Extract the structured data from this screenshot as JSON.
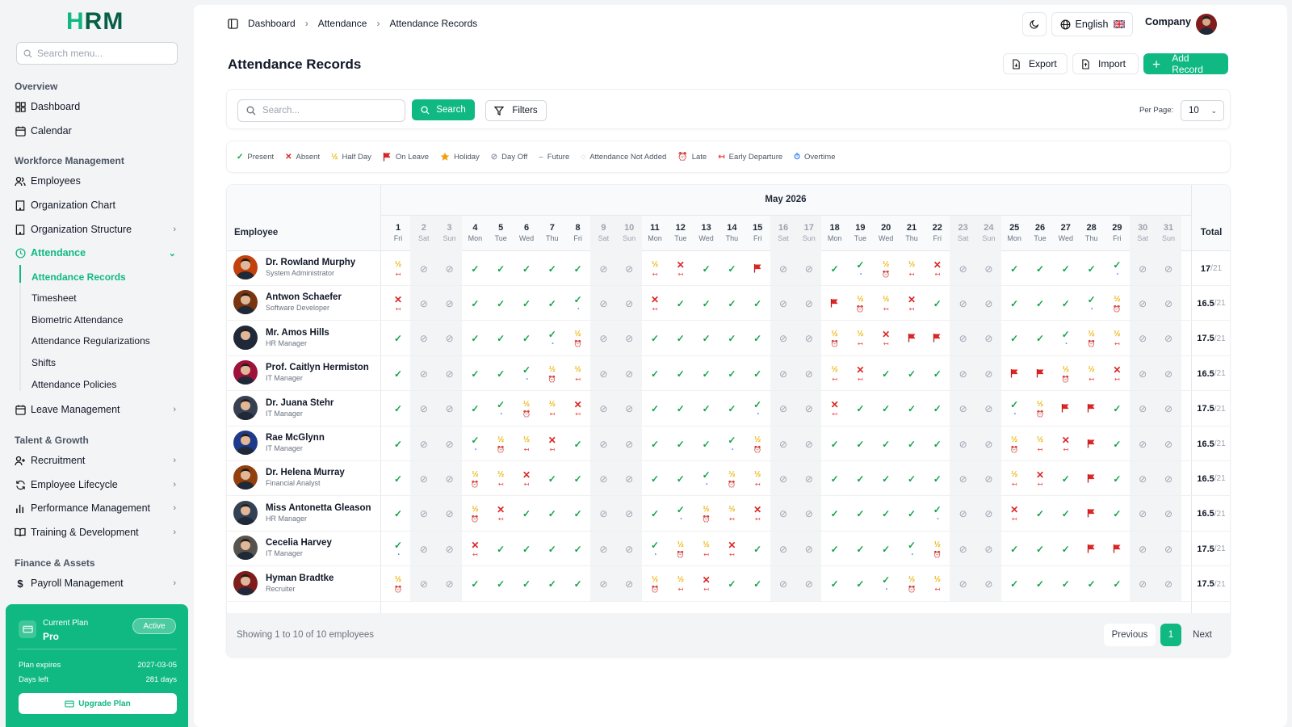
{
  "brand": {
    "logo": "HRM",
    "accent": "#10b981"
  },
  "sidebar": {
    "search_placeholder": "Search menu...",
    "sections": {
      "overview": "Overview",
      "workforce": "Workforce Management",
      "talent": "Talent & Growth",
      "finance": "Finance & Assets"
    },
    "items": {
      "dashboard": "Dashboard",
      "calendar": "Calendar",
      "employees": "Employees",
      "org_chart": "Organization Chart",
      "org_structure": "Organization Structure",
      "attendance": "Attendance",
      "leave": "Leave Management",
      "recruitment": "Recruitment",
      "lifecycle": "Employee Lifecycle",
      "performance": "Performance Management",
      "training": "Training & Development",
      "payroll": "Payroll Management"
    },
    "attendance_sub": [
      "Attendance Records",
      "Timesheet",
      "Biometric Attendance",
      "Attendance Regularizations",
      "Shifts",
      "Attendance Policies"
    ],
    "plan": {
      "label": "Current Plan",
      "name": "Pro",
      "status": "Active",
      "expires_label": "Plan expires",
      "expires_value": "2027-03-05",
      "days_label": "Days left",
      "days_value": "281 days",
      "upgrade": "Upgrade Plan"
    }
  },
  "topbar": {
    "breadcrumb": [
      "Dashboard",
      "Attendance",
      "Attendance Records"
    ],
    "language": "English",
    "company": "Company"
  },
  "page": {
    "title": "Attendance Records",
    "export": "Export",
    "import": "Import",
    "add": "Add Record",
    "search_placeholder": "Search...",
    "search_btn": "Search",
    "filters_btn": "Filters",
    "per_page_label": "Per Page:",
    "per_page_value": "10"
  },
  "legend": [
    {
      "sym": "✓",
      "cls": "p",
      "label": "Present"
    },
    {
      "sym": "✕",
      "cls": "a",
      "label": "Absent"
    },
    {
      "sym": "½",
      "cls": "h",
      "label": "Half Day"
    },
    {
      "sym": "flag",
      "cls": "lv",
      "label": "On Leave"
    },
    {
      "sym": "star",
      "cls": "hol",
      "label": "Holiday"
    },
    {
      "sym": "⊘",
      "cls": "o",
      "label": "Day Off"
    },
    {
      "sym": "–",
      "cls": "o",
      "label": "Future"
    },
    {
      "sym": "◌",
      "cls": "o",
      "label": "Attendance Not Added"
    },
    {
      "sym": "⏰",
      "cls": "l",
      "label": "Late"
    },
    {
      "sym": "↤",
      "cls": "e",
      "label": "Early Departure"
    },
    {
      "sym": "⏱",
      "cls": "v",
      "label": "Overtime"
    }
  ],
  "table": {
    "month": "May 2026",
    "employee_header": "Employee",
    "total_header": "Total",
    "days": [
      {
        "n": "1",
        "w": "Fri"
      },
      {
        "n": "2",
        "w": "Sat"
      },
      {
        "n": "3",
        "w": "Sun"
      },
      {
        "n": "4",
        "w": "Mon"
      },
      {
        "n": "5",
        "w": "Tue"
      },
      {
        "n": "6",
        "w": "Wed"
      },
      {
        "n": "7",
        "w": "Thu"
      },
      {
        "n": "8",
        "w": "Fri"
      },
      {
        "n": "9",
        "w": "Sat"
      },
      {
        "n": "10",
        "w": "Sun"
      },
      {
        "n": "11",
        "w": "Mon"
      },
      {
        "n": "12",
        "w": "Tue"
      },
      {
        "n": "13",
        "w": "Wed"
      },
      {
        "n": "14",
        "w": "Thu"
      },
      {
        "n": "15",
        "w": "Fri"
      },
      {
        "n": "16",
        "w": "Sat"
      },
      {
        "n": "17",
        "w": "Sun"
      },
      {
        "n": "18",
        "w": "Mon"
      },
      {
        "n": "19",
        "w": "Tue"
      },
      {
        "n": "20",
        "w": "Wed"
      },
      {
        "n": "21",
        "w": "Thu"
      },
      {
        "n": "22",
        "w": "Fri"
      },
      {
        "n": "23",
        "w": "Sat"
      },
      {
        "n": "24",
        "w": "Sun"
      },
      {
        "n": "25",
        "w": "Mon"
      },
      {
        "n": "26",
        "w": "Tue"
      },
      {
        "n": "27",
        "w": "Wed"
      },
      {
        "n": "28",
        "w": "Thu"
      },
      {
        "n": "29",
        "w": "Fri"
      },
      {
        "n": "30",
        "w": "Sat"
      },
      {
        "n": "31",
        "w": "Sun"
      }
    ],
    "rows": [
      {
        "name": "Dr. Rowland Murphy",
        "role": "System Administrator",
        "total": "17",
        "of": "/21",
        "cells": [
          "H:e",
          "O",
          "O",
          "P",
          "P",
          "P",
          "P",
          "P",
          "O",
          "O",
          "H:e",
          "A:e",
          "P",
          "P",
          "L",
          "O",
          "O",
          "P",
          "P:v",
          "H:l",
          "H:e",
          "A:e",
          "O",
          "O",
          "P",
          "P",
          "P",
          "P",
          "P:v",
          "O",
          "O"
        ]
      },
      {
        "name": "Antwon Schaefer",
        "role": "Software Developer",
        "total": "16.5",
        "of": "/21",
        "cells": [
          "A:e",
          "O",
          "O",
          "P",
          "P",
          "P",
          "P",
          "P:v",
          "O",
          "O",
          "A:e",
          "P",
          "P",
          "P",
          "P",
          "O",
          "O",
          "L",
          "H:l",
          "H:e",
          "A:e",
          "P",
          "O",
          "O",
          "P",
          "P",
          "P",
          "P:v",
          "H:l",
          "O",
          "O"
        ]
      },
      {
        "name": "Mr. Amos Hills",
        "role": "HR Manager",
        "total": "17.5",
        "of": "/21",
        "cells": [
          "P",
          "O",
          "O",
          "P",
          "P",
          "P",
          "P:v",
          "H:l",
          "O",
          "O",
          "P",
          "P",
          "P",
          "P",
          "P",
          "O",
          "O",
          "H:l",
          "H:e",
          "A:e",
          "L",
          "L",
          "O",
          "O",
          "P",
          "P",
          "P:v",
          "H:l",
          "H:e",
          "O",
          "O"
        ]
      },
      {
        "name": "Prof. Caitlyn Hermiston",
        "role": "IT Manager",
        "total": "16.5",
        "of": "/21",
        "cells": [
          "P",
          "O",
          "O",
          "P",
          "P",
          "P:v",
          "H:l",
          "H:e",
          "O",
          "O",
          "P",
          "P",
          "P",
          "P",
          "P",
          "O",
          "O",
          "H:e",
          "A:e",
          "P",
          "P",
          "P",
          "O",
          "O",
          "L",
          "L",
          "H:l",
          "H:e",
          "A:e",
          "O",
          "O"
        ]
      },
      {
        "name": "Dr. Juana Stehr",
        "role": "IT Manager",
        "total": "17.5",
        "of": "/21",
        "cells": [
          "P",
          "O",
          "O",
          "P",
          "P:v",
          "H:l",
          "H:e",
          "A:e",
          "O",
          "O",
          "P",
          "P",
          "P",
          "P",
          "P:v",
          "O",
          "O",
          "A:e",
          "P",
          "P",
          "P",
          "P",
          "O",
          "O",
          "P:v",
          "H:l",
          "L",
          "L",
          "P",
          "O",
          "O"
        ]
      },
      {
        "name": "Rae McGlynn",
        "role": "IT Manager",
        "total": "16.5",
        "of": "/21",
        "cells": [
          "P",
          "O",
          "O",
          "P:v",
          "H:l",
          "H:e",
          "A:e",
          "P",
          "O",
          "O",
          "P",
          "P",
          "P",
          "P:v",
          "H:l",
          "O",
          "O",
          "P",
          "P",
          "P",
          "P",
          "P",
          "O",
          "O",
          "H:l",
          "H:e",
          "A:e",
          "L",
          "P",
          "O",
          "O"
        ]
      },
      {
        "name": "Dr. Helena Murray",
        "role": "Financial Analyst",
        "total": "16.5",
        "of": "/21",
        "cells": [
          "P",
          "O",
          "O",
          "H:l",
          "H:e",
          "A:e",
          "P",
          "P",
          "O",
          "O",
          "P",
          "P",
          "P:v",
          "H:l",
          "H:e",
          "O",
          "O",
          "P",
          "P",
          "P",
          "P",
          "P",
          "O",
          "O",
          "H:e",
          "A:e",
          "P",
          "L",
          "P",
          "O",
          "O"
        ]
      },
      {
        "name": "Miss Antonetta Gleason",
        "role": "HR Manager",
        "total": "16.5",
        "of": "/21",
        "cells": [
          "P",
          "O",
          "O",
          "H:l",
          "A:e",
          "P",
          "P",
          "P",
          "O",
          "O",
          "P",
          "P:v",
          "H:l",
          "H:e",
          "A:e",
          "O",
          "O",
          "P",
          "P",
          "P",
          "P",
          "P:v",
          "O",
          "O",
          "A:e",
          "P",
          "P",
          "L",
          "P",
          "O",
          "O"
        ]
      },
      {
        "name": "Cecelia Harvey",
        "role": "IT Manager",
        "total": "17.5",
        "of": "/21",
        "cells": [
          "P:v",
          "O",
          "O",
          "A:e",
          "P",
          "P",
          "P",
          "P",
          "O",
          "O",
          "P:v",
          "H:l",
          "H:e",
          "A:e",
          "P",
          "O",
          "O",
          "P",
          "P",
          "P",
          "P:v",
          "H:l",
          "O",
          "O",
          "P",
          "P",
          "P",
          "L",
          "L",
          "O",
          "O"
        ]
      },
      {
        "name": "Hyman Bradtke",
        "role": "Recruiter",
        "total": "17.5",
        "of": "/21",
        "cells": [
          "H:l",
          "O",
          "O",
          "P",
          "P",
          "P",
          "P",
          "P",
          "O",
          "O",
          "H:l",
          "H:e",
          "A:e",
          "P",
          "P",
          "O",
          "O",
          "P",
          "P",
          "P:v",
          "H:l",
          "H:e",
          "O",
          "O",
          "P",
          "P",
          "P",
          "P",
          "P",
          "O",
          "O"
        ]
      }
    ],
    "avatar_colors": [
      "#c2410c",
      "#78350f",
      "#1f2937",
      "#9f1239",
      "#374151",
      "#1e3a8a",
      "#92400e",
      "#334155",
      "#57534e",
      "#7f1d1d"
    ]
  },
  "footer": {
    "showing": "Showing 1 to 10 of 10 employees",
    "prev": "Previous",
    "page": "1",
    "next": "Next"
  }
}
